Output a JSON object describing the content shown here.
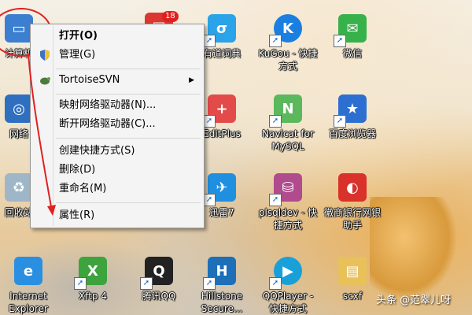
{
  "context_menu": {
    "items": [
      {
        "label": "打开(O)"
      },
      {
        "label": "管理(G)"
      },
      {
        "label": "TortoiseSVN"
      },
      {
        "label": "映射网络驱动器(N)..."
      },
      {
        "label": "断开网络驱动器(C)..."
      },
      {
        "label": "创建快捷方式(S)"
      },
      {
        "label": "删除(D)"
      },
      {
        "label": "重命名(M)"
      },
      {
        "label": "属性(R)"
      }
    ]
  },
  "desktop_icons": [
    {
      "label": "计算机",
      "icon": "computer-icon"
    },
    {
      "label": "网络",
      "icon": "network-icon"
    },
    {
      "label": "回收站",
      "icon": "recycle-bin-icon"
    },
    {
      "label": "Internet Explorer",
      "icon": "ie-icon"
    },
    {
      "label": "Xftp 4",
      "icon": "xftp-icon"
    },
    {
      "label": "腾讯QQ",
      "icon": "qq-icon"
    },
    {
      "label": "有道词典",
      "icon": "youdao-icon"
    },
    {
      "label": "EditPlus",
      "icon": "editplus-icon"
    },
    {
      "label": "迅雷7",
      "icon": "xunlei-icon"
    },
    {
      "label": "Hillstone Secure...",
      "icon": "hillstone-icon"
    },
    {
      "label": "KuGou - 快捷方式",
      "icon": "kugou-icon"
    },
    {
      "label": "Navicat for MySQL",
      "icon": "navicat-icon"
    },
    {
      "label": "plsqldev - 快捷方式",
      "icon": "plsqldev-icon"
    },
    {
      "label": "QQPlayer - 快捷方式",
      "icon": "qqplayer-icon"
    },
    {
      "label": "微信",
      "icon": "wechat-icon"
    },
    {
      "label": "百度浏览器",
      "icon": "baidu-browser-icon"
    },
    {
      "label": "徽商银行网银助手",
      "icon": "bank-icon"
    },
    {
      "label": "scxf",
      "icon": "folder-icon"
    }
  ],
  "badge_count": "18",
  "watermark": "头条 @范翠儿呀",
  "colors": {
    "annotation_red": "#e02020",
    "menu_bg": "#f4f4f4"
  }
}
